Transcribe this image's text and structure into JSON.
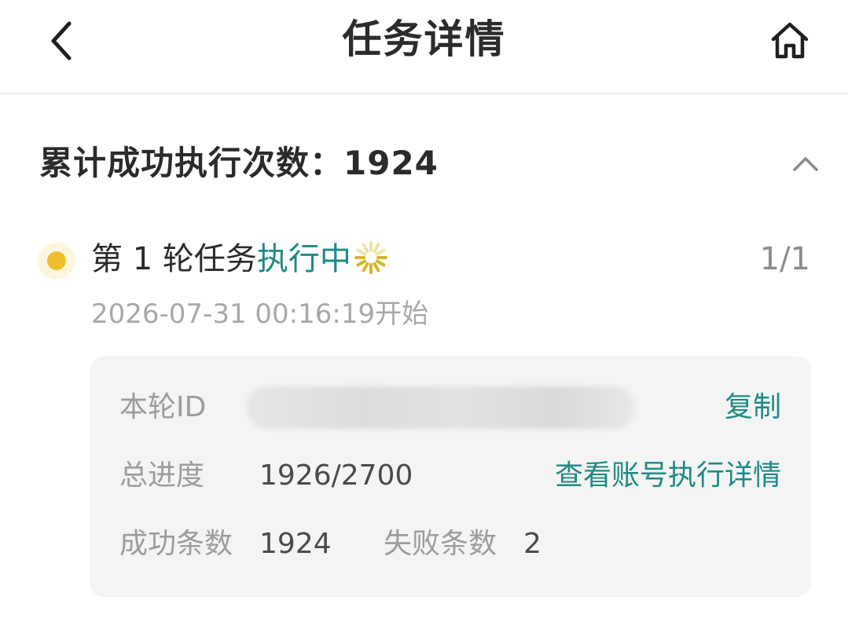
{
  "header": {
    "title": "任务详情",
    "back_icon": "chevron-left-icon",
    "home_icon": "home-icon"
  },
  "summary": {
    "text": "累计成功执行次数：1924",
    "toggle_icon": "chevron-up-icon"
  },
  "round": {
    "title_prefix": "第 1 轮任务",
    "status": "执行中",
    "count": "1/1",
    "start_time": "2026-07-31 00:16:19开始",
    "status_color": "#1e8a84",
    "dot_color": "#eebf2c",
    "spinner_icon": "loading-spinner-icon"
  },
  "details": {
    "round_id_label": "本轮ID",
    "copy_label": "复制",
    "progress_label": "总进度",
    "progress_value": "1926/2700",
    "view_details_label": "查看账号执行详情",
    "success_label": "成功条数",
    "success_value": "1924",
    "fail_label": "失败条数",
    "fail_value": "2"
  },
  "colors": {
    "accent": "#1e8a84",
    "card_bg": "#f4f4f4"
  }
}
